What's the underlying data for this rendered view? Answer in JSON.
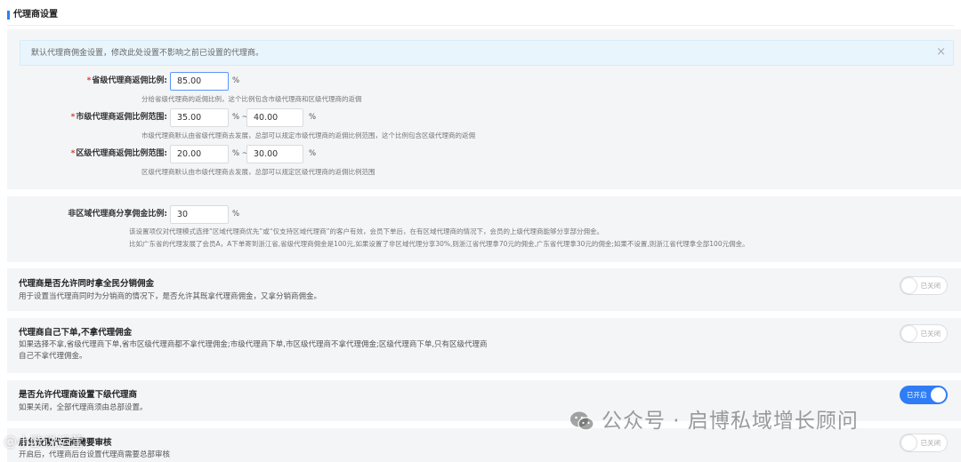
{
  "page": {
    "title": "代理商设置"
  },
  "alert": {
    "text": "默认代理商佣金设置，修改此处设置不影响之前已设置的代理商。",
    "close_icon": "×"
  },
  "commission": {
    "province": {
      "label": "省级代理商返佣比例:",
      "value": "85.00",
      "unit": "%",
      "help": "分给省级代理商的返佣比例，这个比例包含市级代理商和区级代理商的返佣"
    },
    "city": {
      "label": "市级代理商返佣比例范围:",
      "min": "35.00",
      "max": "40.00",
      "sep": "% ~",
      "unit": "%",
      "help": "市级代理商默认由省级代理商去发展，总部可以规定市级代理商的返佣比例范围，这个比例包含区级代理商的返佣"
    },
    "district": {
      "label": "区级代理商返佣比例范围:",
      "min": "20.00",
      "max": "30.00",
      "sep": "% ~",
      "unit": "%",
      "help": "区级代理商默认由市级代理商去发展，总部可以规定区级代理商的返佣比例范围"
    },
    "required_mark": "*"
  },
  "non_region": {
    "label": "非区域代理商分享佣金比例:",
    "value": "30",
    "unit": "%",
    "help1": "该设置项仅对代理模式选择“区域代理商优先”或“仅支持区域代理商”的客户有效，会员下单后，在有区域代理商的情况下，会员的上级代理商能够分享部分佣金。",
    "help2": "比如广东省的代理发展了会员A，A下单寄到浙江省,省级代理商佣金是100元,如果设置了非区域代理分享30%,则浙江省代理拿70元的佣金,广东省代理拿30元的佣金;如果不设置,则浙江省代理拿全部100元佣金。"
  },
  "settings": [
    {
      "title": "代理商是否允许同时拿全民分销佣金",
      "desc": "用于设置当代理商同时为分销商的情况下，是否允许其既拿代理商佣金，又拿分销商佣金。",
      "state": "已关闭",
      "on": false
    },
    {
      "title": "代理商自己下单,不拿代理佣金",
      "desc": "如果选择不拿,省级代理商下单,省市区级代理商都不拿代理佣金;市级代理商下单,市区级代理商不拿代理佣金;区级代理商下单,只有区级代理商自己不拿代理佣金。",
      "state": "已关闭",
      "on": false
    },
    {
      "title": "是否允许代理商设置下级代理商",
      "desc": "如果关闭，全部代理商须由总部设置。",
      "state": "已开启",
      "on": true
    },
    {
      "title": "后台设置代理商需要审核",
      "desc": "开启后，代理商后台设置代理商需要总部审核",
      "state": "已关闭",
      "on": false
    }
  ],
  "watermark": {
    "text": "公众号 · 启博私域增长顾问",
    "corner": "@小欧说运营",
    "icon": "wechat-icon"
  },
  "colors": {
    "accent": "#2f7df6",
    "required": "#e2372f",
    "alert_bg": "#e9f5fd"
  }
}
